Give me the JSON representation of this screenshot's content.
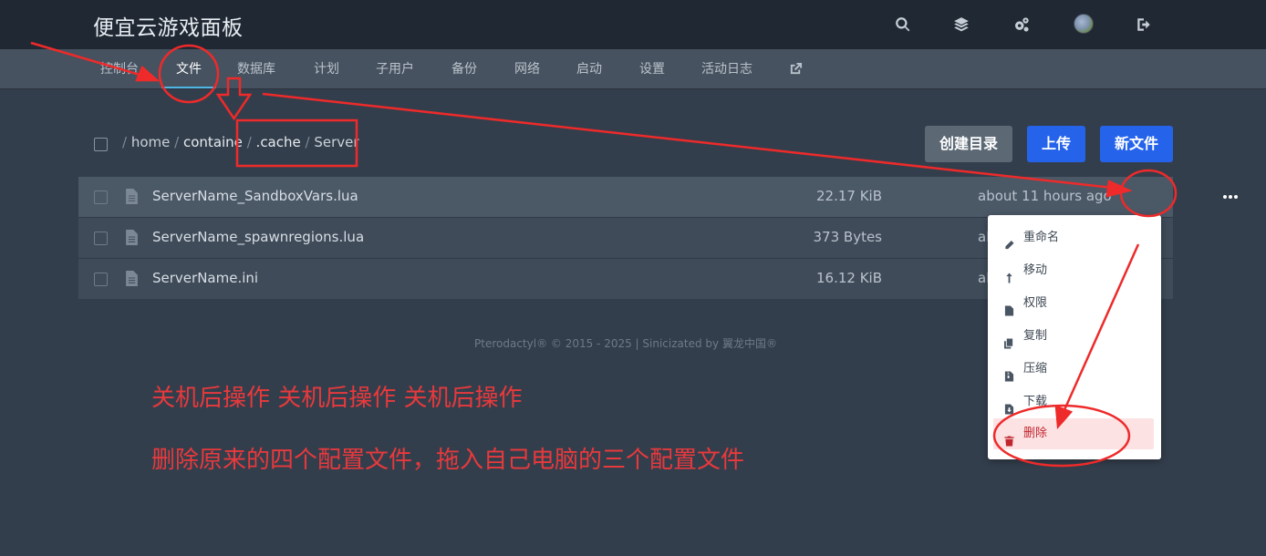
{
  "header": {
    "title": "便宜云游戏面板",
    "icons": [
      "search-icon",
      "layers-icon",
      "cogs-icon",
      "avatar",
      "sign-out-icon"
    ]
  },
  "nav": {
    "tabs": [
      {
        "label": "控制台"
      },
      {
        "label": "文件"
      },
      {
        "label": "数据库"
      },
      {
        "label": "计划"
      },
      {
        "label": "子用户"
      },
      {
        "label": "备份"
      },
      {
        "label": "网络"
      },
      {
        "label": "启动"
      },
      {
        "label": "设置"
      },
      {
        "label": "活动日志"
      }
    ],
    "active": "文件",
    "external_icon": "external-link-icon"
  },
  "breadcrumb": {
    "separator": "/",
    "segments": [
      "home",
      "containe",
      ".cache",
      "Server"
    ]
  },
  "actions": {
    "create_dir": "创建目录",
    "upload": "上传",
    "new_file": "新文件"
  },
  "files": [
    {
      "name": "ServerName_SandboxVars.lua",
      "size": "22.17 KiB",
      "modified": "about 11 hours ago"
    },
    {
      "name": "ServerName_spawnregions.lua",
      "size": "373 Bytes",
      "modified": "al"
    },
    {
      "name": "ServerName.ini",
      "size": "16.12 KiB",
      "modified": "al"
    }
  ],
  "context_menu": {
    "rename": "重命名",
    "move": "移动",
    "permissions": "权限",
    "copy": "复制",
    "compress": "压缩",
    "download": "下载",
    "delete": "删除"
  },
  "footer": "Pterodactyl® © 2015 - 2025 | Sinicizated by 翼龙中国®",
  "annotations": {
    "line1": "关机后操作 关机后操作 关机后操作",
    "line2": "删除原来的四个配置文件，拖入自己电脑的三个配置文件"
  },
  "colors": {
    "topbar": "#1f2833",
    "subnav": "#46525f",
    "body": "#333e4c",
    "accent_blue": "#2563eb",
    "annotation_red": "#e8393c",
    "tab_underline": "#4fb7e6"
  }
}
